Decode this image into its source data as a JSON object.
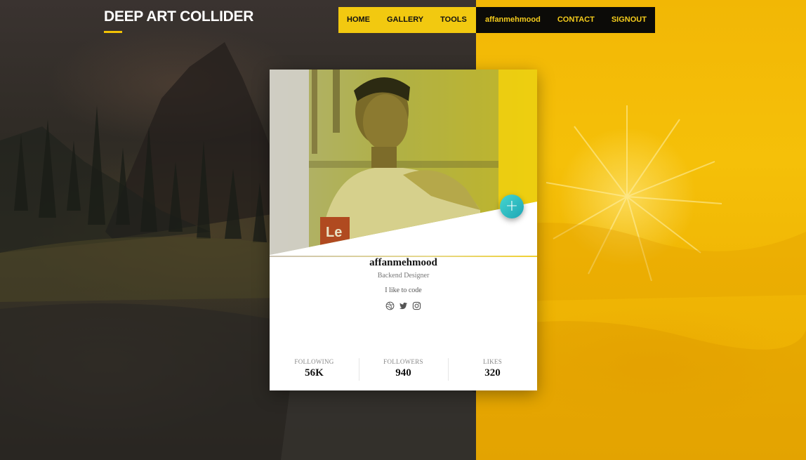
{
  "header": {
    "brand": "DEEP ART COLLIDER"
  },
  "nav": {
    "items": [
      {
        "label": "HOME"
      },
      {
        "label": "GALLERY"
      },
      {
        "label": "TOOLS"
      },
      {
        "label": "affanmehmood"
      },
      {
        "label": "CONTACT"
      },
      {
        "label": "SIGNOUT"
      }
    ]
  },
  "profile": {
    "name": "affanmehmood",
    "role": "Backend Designer",
    "bio": "I like to code",
    "socials": [
      "dribbble-icon",
      "twitter-icon",
      "instagram-icon"
    ],
    "add_button": "+",
    "stats": [
      {
        "label": "FOLLOWING",
        "value": "56K"
      },
      {
        "label": "FOLLOWERS",
        "value": "940"
      },
      {
        "label": "LIKES",
        "value": "320"
      }
    ]
  },
  "colors": {
    "accent_yellow": "#f2c910",
    "nav_dark": "#0c0b08",
    "plus_teal": "#2fbcc3"
  }
}
